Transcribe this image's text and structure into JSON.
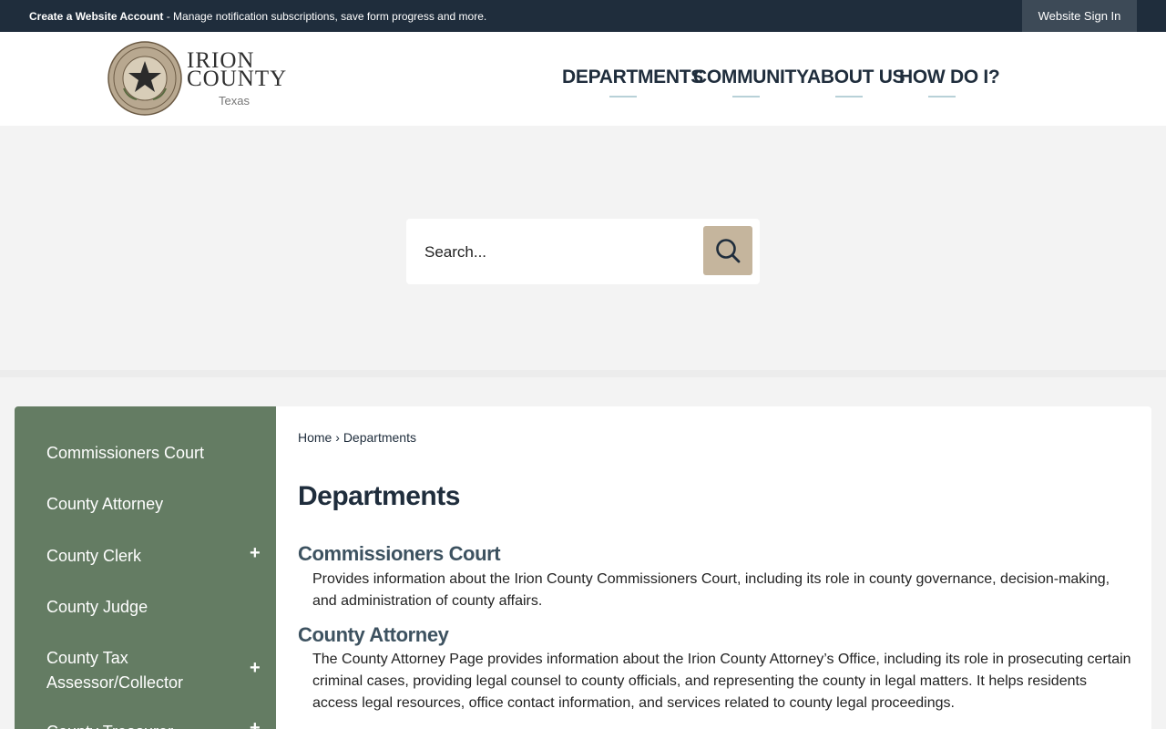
{
  "topbar": {
    "create_account": "Create a Website Account",
    "message": " - Manage notification subscriptions, save form progress and more.",
    "signin_label": "Website Sign In"
  },
  "logo": {
    "line1": "IRION",
    "line2": "COUNTY",
    "line3": "Texas",
    "seal_top_text": "THE STATE OF TEXAS",
    "seal_bottom_text": "COUNTY OF IRION"
  },
  "nav": {
    "items": [
      {
        "label": "DEPARTMENTS"
      },
      {
        "label": "COMMUNITY"
      },
      {
        "label": "ABOUT US"
      },
      {
        "label": "HOW DO I?"
      }
    ]
  },
  "search": {
    "placeholder": "Search...",
    "icon": "search-icon"
  },
  "sidebar": {
    "items": [
      {
        "label": "Commissioners Court",
        "expandable": false
      },
      {
        "label": "County Attorney",
        "expandable": false
      },
      {
        "label": "County Clerk",
        "expandable": true
      },
      {
        "label": "County Judge",
        "expandable": false
      },
      {
        "label": "County Tax Assessor/Collector",
        "expandable": true
      },
      {
        "label": "County Treasurer",
        "expandable": true
      }
    ],
    "expand_symbol": "+"
  },
  "breadcrumb": {
    "home": "Home",
    "separator": "›",
    "current": "Departments"
  },
  "main": {
    "title": "Departments",
    "departments": [
      {
        "name": "Commissioners Court",
        "description": "Provides information about the Irion County Commissioners Court, including its role in county governance, decision-making, and administration of county affairs."
      },
      {
        "name": "County Attorney",
        "description": "The County Attorney Page provides information about the Irion County Attorney’s Office, including its role in prosecuting certain criminal cases, providing legal counsel to county officials, and representing the county in legal matters. It helps residents access legal resources, office contact information, and services related to county legal proceedings."
      }
    ]
  },
  "colors": {
    "topbar": "#1f2d3c",
    "sidebar": "#647c63",
    "search_button": "#c5b59d",
    "nav_underline": "#b8d1d8"
  }
}
